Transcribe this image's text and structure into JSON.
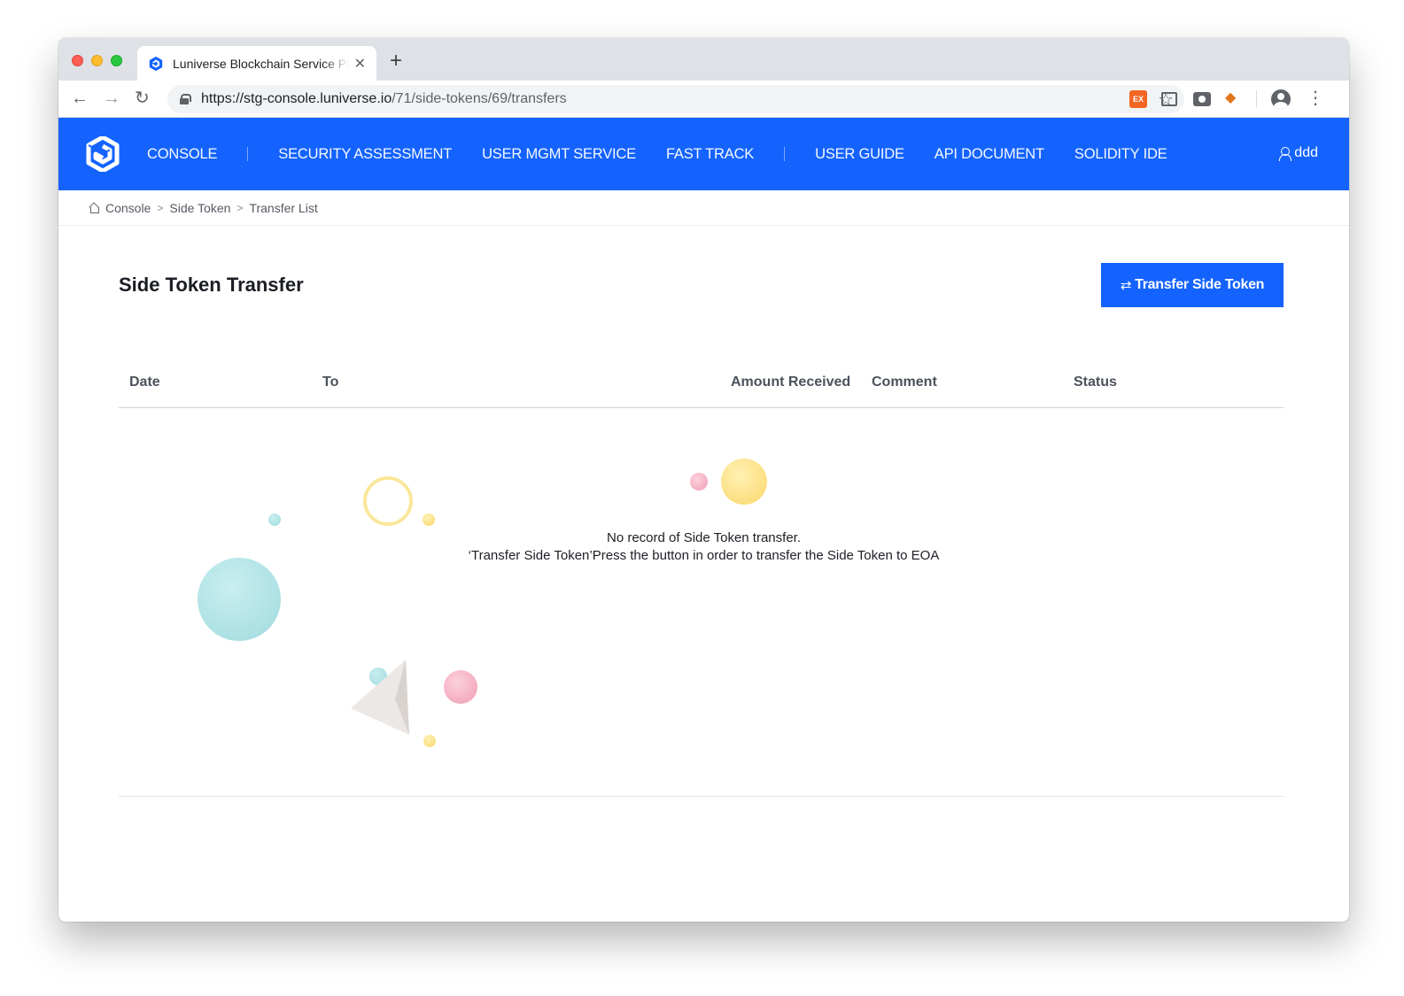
{
  "browser": {
    "tab_title": "Luniverse Blockchain Service Platform",
    "url_host": "https://stg-console.luniverse.io",
    "url_path": "/71/side-tokens/69/transfers",
    "ext_label": "EX"
  },
  "app": {
    "nav": [
      "CONSOLE",
      "SECURITY ASSESSMENT",
      "USER MGMT SERVICE",
      "FAST TRACK",
      "USER GUIDE",
      "API DOCUMENT",
      "SOLIDITY IDE"
    ],
    "user": "ddd",
    "brand_color": "#1463ff"
  },
  "breadcrumb": [
    "Console",
    "Side Token",
    "Transfer List"
  ],
  "page": {
    "title": "Side Token Transfer",
    "primary_button": "Transfer Side Token",
    "table": {
      "columns": [
        "Date",
        "To",
        "Amount Received",
        "Comment",
        "Status"
      ],
      "rows": []
    },
    "empty_line1": "No record of Side Token transfer.",
    "empty_line2": "‘Transfer Side Token’Press the button in order to transfer the Side Token to EOA"
  }
}
